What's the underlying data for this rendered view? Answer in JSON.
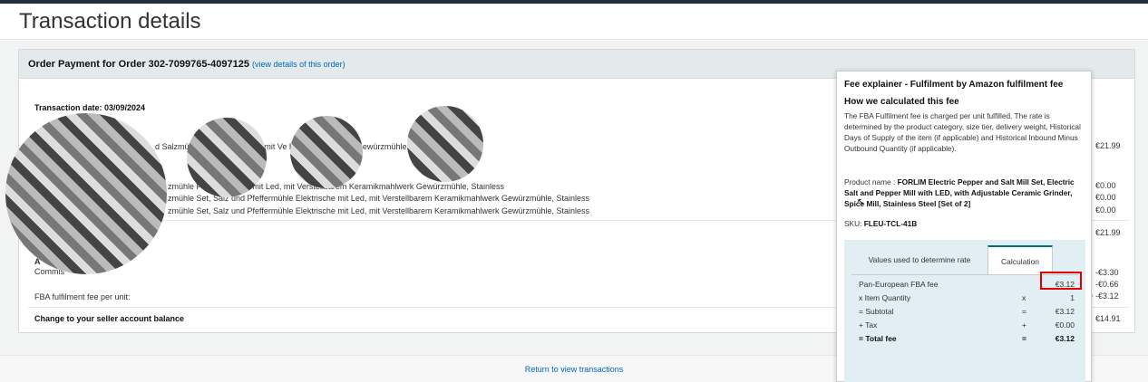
{
  "page": {
    "title": "Transaction details"
  },
  "card": {
    "title": "Order Payment for Order 302-7099765-4097125",
    "link_open": "(",
    "link": "view details of this order",
    "link_close": ")",
    "transaction_date": "Transaction date: 03/09/2024"
  },
  "rows": {
    "r1": "d Salzmühle                Pfeffermühle                                     ed, mit Ve                     Keramikmahlwerk Gewürzmühle, Stainless",
    "r2": "zmühle                 Pfeffermühle E                        mit Led, mit Verstellbarem Keramikmahlwerk Gewürzmühle, Stainless",
    "r3": "zmühle Set, Salz und Pfeffermühle Elektrische mit Led, mit Verstellbarem Keramikmahlwerk Gewürzmühle, Stainless",
    "r4": "zmühle Set, Salz und Pfeffermühle Elektrische mit Led, mit Verstellbarem Keramikmahlwerk Gewürzmühle, Stainless",
    "commission_prefix": "A",
    "commission": "Commis",
    "fba": "FBA fulfilment fee per unit:",
    "balance": "Change to your seller account balance"
  },
  "amounts": {
    "a1": "€21.99",
    "a2": "€0.00",
    "a3": "€0.00",
    "a4": "€0.00",
    "a5": "€21.99",
    "a6": "-€3.30",
    "a7": "-€0.66",
    "a8": "-€3.12",
    "a9": "€14.91"
  },
  "footer": {
    "return_link": "Return to view transactions"
  },
  "popup": {
    "title": "Fee explainer - Fulfilment by Amazon fulfilment fee",
    "heading": "How we calculated this fee",
    "description": "The FBA Fulfilment fee is charged per unit fulfilled. The rate is determined by the product category, size tier, delivery weight, Historical Days of Supply of the item (if applicable) and Historical Inbound Minus Outbound Quantity (if applicable).",
    "product_label": "Product name :",
    "product_name": "FORLIM Electric Pepper and Salt Mill Set, Electric Salt and Pepper Mill with LED, with Adjustable Ceramic Grinder, Spice Mill, Stainless Steel [Set of 2]",
    "sku_label": "SKU:",
    "sku": "FLEU-TCL-41B",
    "tabs": [
      "Values used to determine rate",
      "Calculation"
    ],
    "calc": [
      {
        "label": "Pan-European FBA fee",
        "op": "",
        "value": "€3.12"
      },
      {
        "label": "x Item Quantity",
        "op": "x",
        "value": "1"
      },
      {
        "label": "= Subtotal",
        "op": "=",
        "value": "€3.12"
      },
      {
        "label": "+ Tax",
        "op": "+",
        "value": "€0.00"
      },
      {
        "label": "= Total fee",
        "op": "=",
        "value": "€3.12"
      }
    ]
  },
  "colors": {
    "highlight": "#e00000",
    "link": "#0066c0",
    "tab_accent": "#007185",
    "calc_bg": "#e1eef4"
  }
}
